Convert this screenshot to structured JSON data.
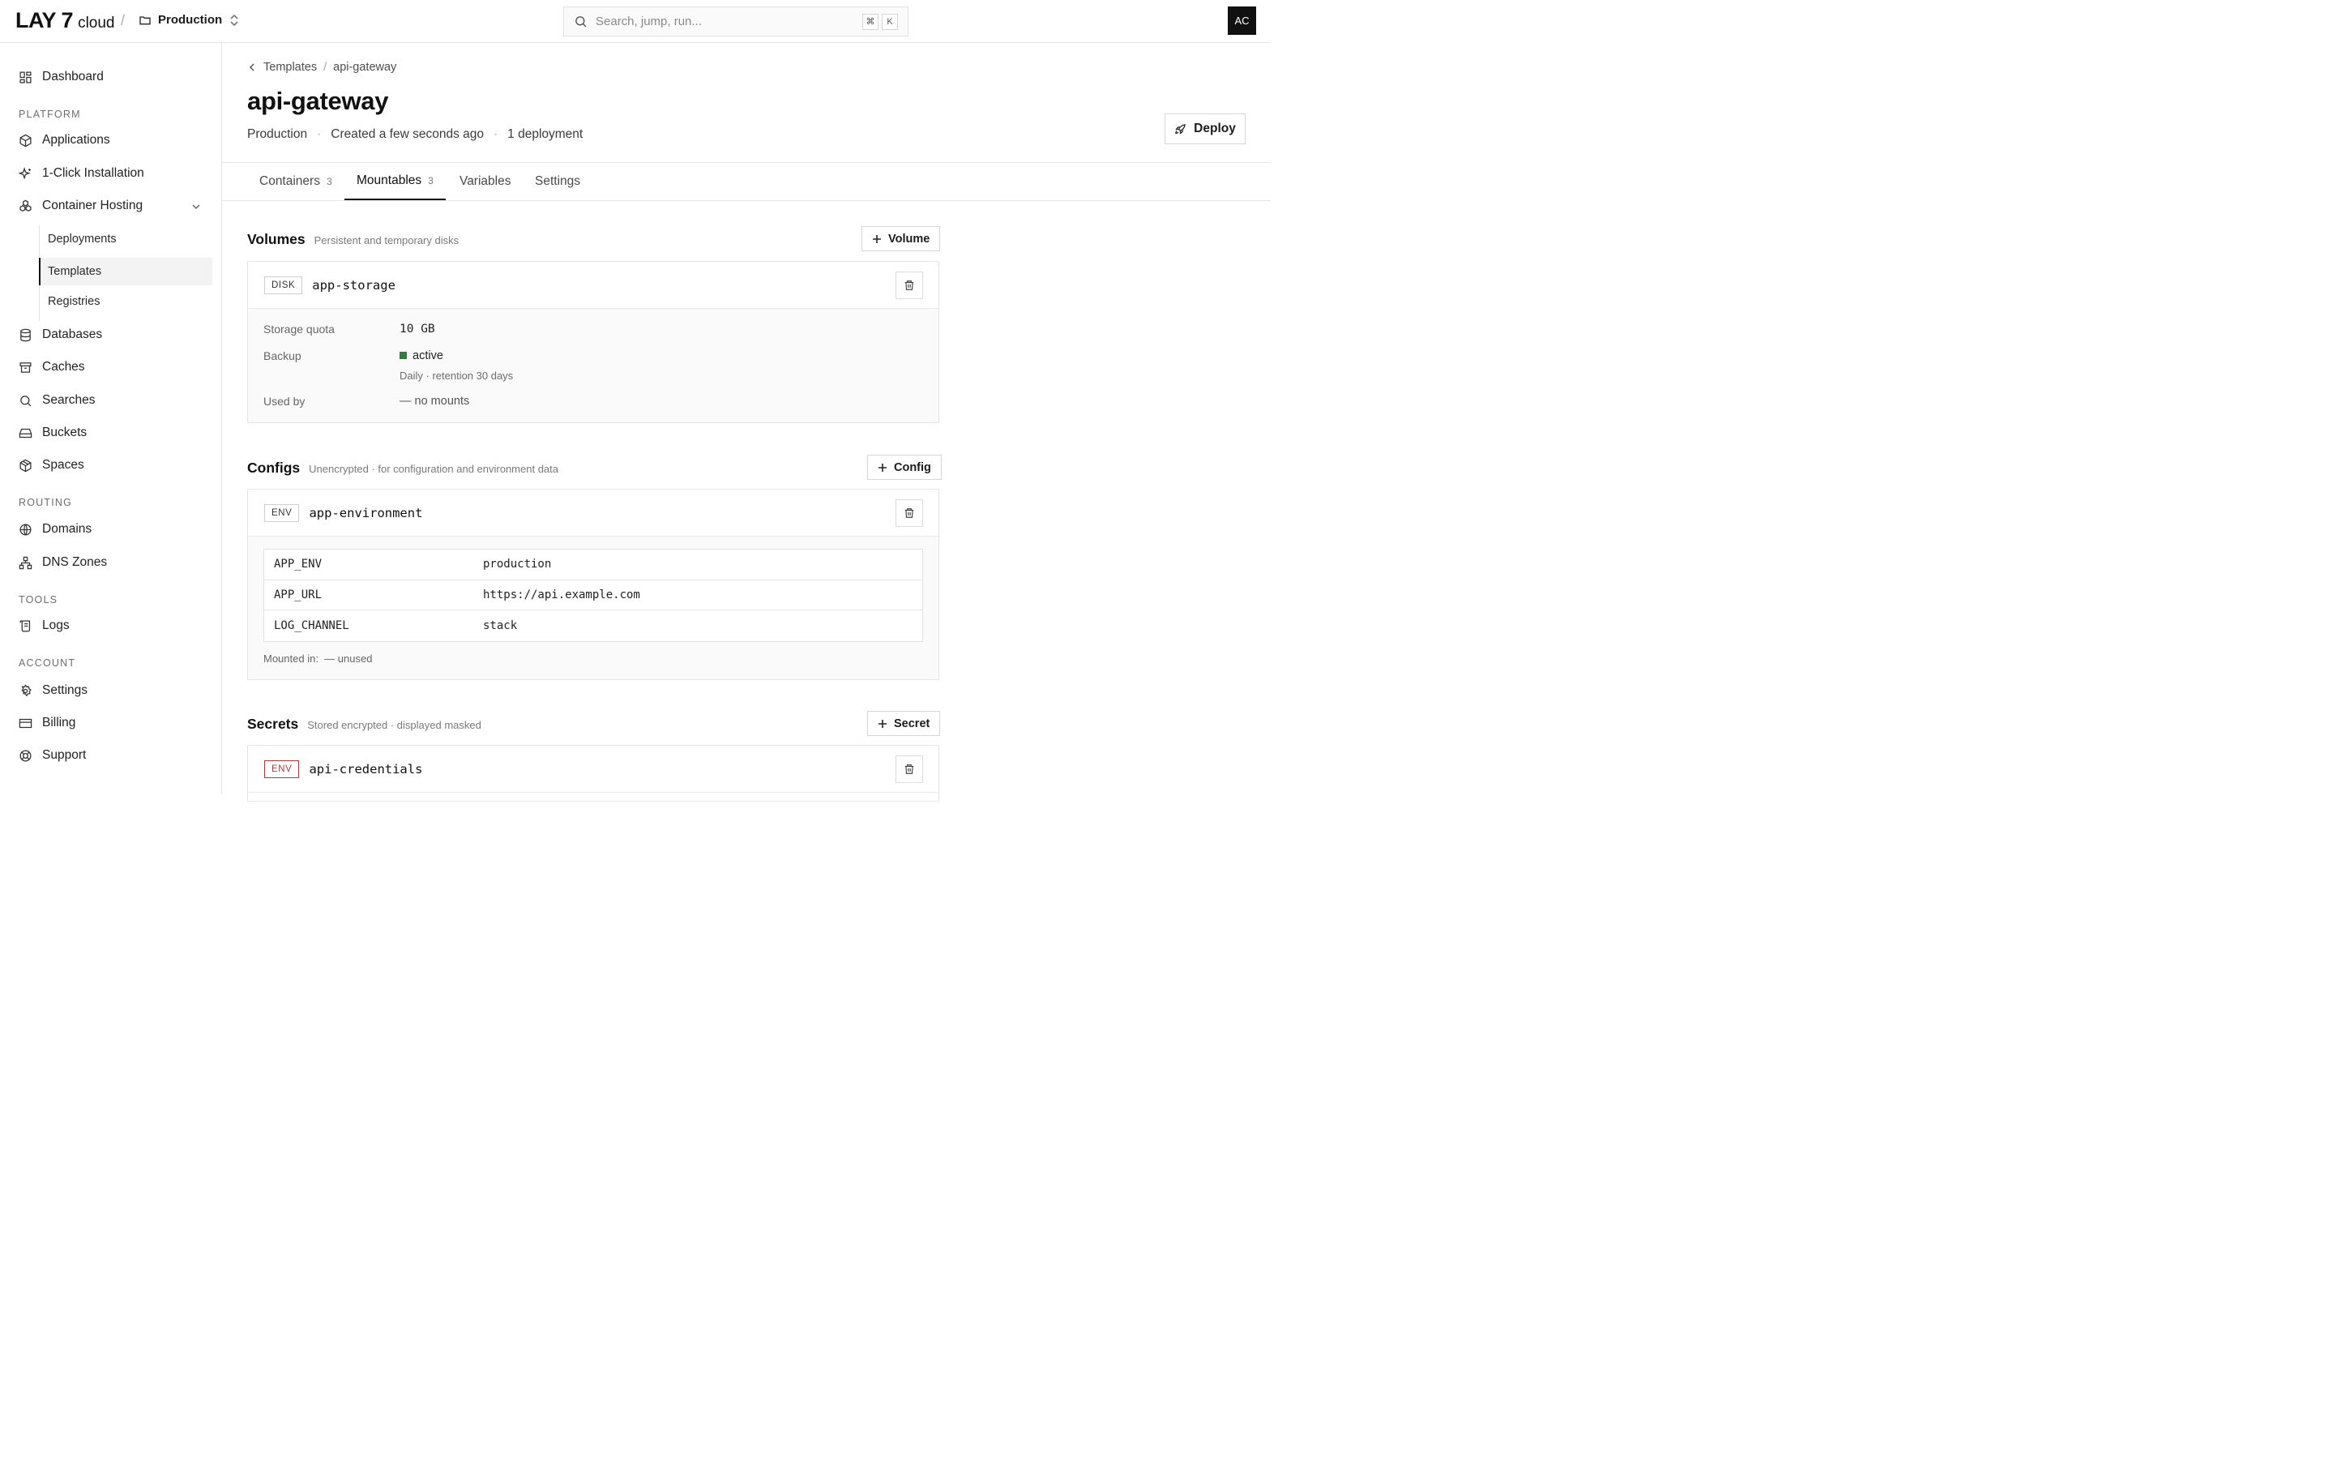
{
  "header": {
    "brand": "LAY 7",
    "brand_sub": "cloud",
    "project": "Production",
    "search_placeholder": "Search, jump, run...",
    "kbd_cmd": "⌘",
    "kbd_key": "K",
    "avatar_initials": "AC"
  },
  "sidebar": {
    "dashboard": "Dashboard",
    "platform_label": "PLATFORM",
    "applications": "Applications",
    "one_click": "1-Click Installation",
    "container_hosting": "Container Hosting",
    "sub": {
      "deployments": "Deployments",
      "templates": "Templates",
      "registries": "Registries"
    },
    "databases": "Databases",
    "caches": "Caches",
    "searches": "Searches",
    "buckets": "Buckets",
    "spaces": "Spaces",
    "routing_label": "ROUTING",
    "domains": "Domains",
    "dns_zones": "DNS Zones",
    "tools_label": "TOOLS",
    "logs": "Logs",
    "account_label": "ACCOUNT",
    "settings": "Settings",
    "billing": "Billing",
    "support": "Support"
  },
  "page": {
    "breadcrumb_parent": "Templates",
    "breadcrumb_sep": "/",
    "breadcrumb_current": "api-gateway",
    "title": "api-gateway",
    "meta_project": "Production",
    "meta_created": "Created a few seconds ago",
    "meta_deployments": "1 deployment",
    "meta_dot": "·",
    "deploy_label": "Deploy"
  },
  "tabs": [
    {
      "label": "Containers",
      "count": "3"
    },
    {
      "label": "Mountables",
      "count": "3"
    },
    {
      "label": "Variables",
      "count": ""
    },
    {
      "label": "Settings",
      "count": ""
    }
  ],
  "volumes": {
    "title": "Volumes",
    "subtitle": "Persistent and temporary disks",
    "add_label": "Volume",
    "card": {
      "badge": "DISK",
      "name": "app-storage",
      "storage_label": "Storage quota",
      "storage_value": "10 GB",
      "backup_label": "Backup",
      "backup_status": "active",
      "backup_detail": "Daily · retention 30 days",
      "usedby_label": "Used by",
      "usedby_value": "— no mounts"
    }
  },
  "configs": {
    "title": "Configs",
    "subtitle": "Unencrypted · for configuration and environment data",
    "add_label": "Config",
    "card": {
      "badge": "ENV",
      "name": "app-environment",
      "rows": [
        {
          "key": "APP_ENV",
          "value": "production"
        },
        {
          "key": "APP_URL",
          "value": "https://api.example.com"
        },
        {
          "key": "LOG_CHANNEL",
          "value": "stack"
        }
      ],
      "mounted_label": "Mounted in:",
      "mounted_value": "— unused"
    }
  },
  "secrets": {
    "title": "Secrets",
    "subtitle": "Stored encrypted · displayed masked",
    "add_label": "Secret",
    "card": {
      "badge": "ENV",
      "name": "api-credentials"
    }
  },
  "colors": {
    "accent": "#111111",
    "status_active": "#2f7d3e",
    "secret_badge": "#b03a3a"
  }
}
